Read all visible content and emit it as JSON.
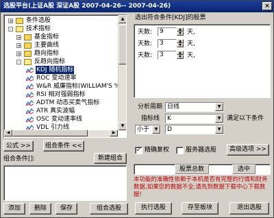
{
  "window": {
    "title": "选股平台(上证A股 深证A股    2007-04-26-- 2007-04-26)",
    "close_glyph": "×"
  },
  "tree": {
    "items": [
      {
        "label": "条件选股",
        "expander": "+",
        "kind": "folder"
      },
      {
        "label": "技术指标",
        "expander": "-",
        "kind": "folder-open"
      },
      {
        "label": "基金指标",
        "expander": "+",
        "kind": "folder"
      },
      {
        "label": "主要曲线",
        "expander": "+",
        "kind": "folder"
      },
      {
        "label": "趋向指标",
        "expander": "+",
        "kind": "folder"
      },
      {
        "label": "反趋向指标",
        "expander": "-",
        "kind": "folder-open"
      },
      {
        "label": "KDJ 随机指标",
        "kind": "indicator",
        "selected": true
      },
      {
        "label": "ROC 变动速率",
        "kind": "indicator"
      },
      {
        "label": "W&R 威廉指标(WILLIAM'S %",
        "kind": "indicator"
      },
      {
        "label": "RSI 相对强弱指标",
        "kind": "indicator"
      },
      {
        "label": "ADTM 动态买卖气指标",
        "kind": "indicator"
      },
      {
        "label": "ATR 真实波幅",
        "kind": "indicator"
      },
      {
        "label": "OSC 变动速率线",
        "kind": "indicator"
      },
      {
        "label": "VDL 引力线",
        "kind": "indicator"
      }
    ]
  },
  "left_buttons": {
    "formula": "公式 >>",
    "combo_condition": "组合条件 <<",
    "new_combo": "新建组合"
  },
  "combo_label": "组合条件[]:",
  "bottom_left_buttons": {
    "add": "添加",
    "delete": "删除",
    "save": "保存",
    "combo_pick": "组合选股"
  },
  "right_panel": {
    "header": "选出符合条件[KDJ]的股票",
    "params": [
      {
        "label": "天数:",
        "value": "9",
        "unit": "天,"
      },
      {
        "label": "天数:",
        "value": "3",
        "unit": "天,"
      },
      {
        "label": "天数:",
        "value": "3",
        "unit": "天,"
      }
    ],
    "period_label": "分析周期",
    "period_value": "日线",
    "indicator_label": "指标线",
    "indicator_value": "K",
    "satisfy_label": "满足以下条件",
    "comparator_value": "小于",
    "target_value": "D",
    "check_exact_rights": {
      "label": "精确复权",
      "checked": true
    },
    "check_server_pick": {
      "label": "服务器选股",
      "checked": false
    },
    "advanced_button": "高级选项 >>",
    "stat_total_label": "股票总数",
    "stat_selected_label": "选中",
    "warning_text": "本功能的准确性依赖于本机是否有完整的行情和财务数据,如果您的数据不全,请先到数据下载中心下载数据!",
    "warning_color": "#c00000"
  },
  "footer_buttons": {
    "execute": "执行选股",
    "save_to_block": "存至板块",
    "exit": "退出选股"
  }
}
